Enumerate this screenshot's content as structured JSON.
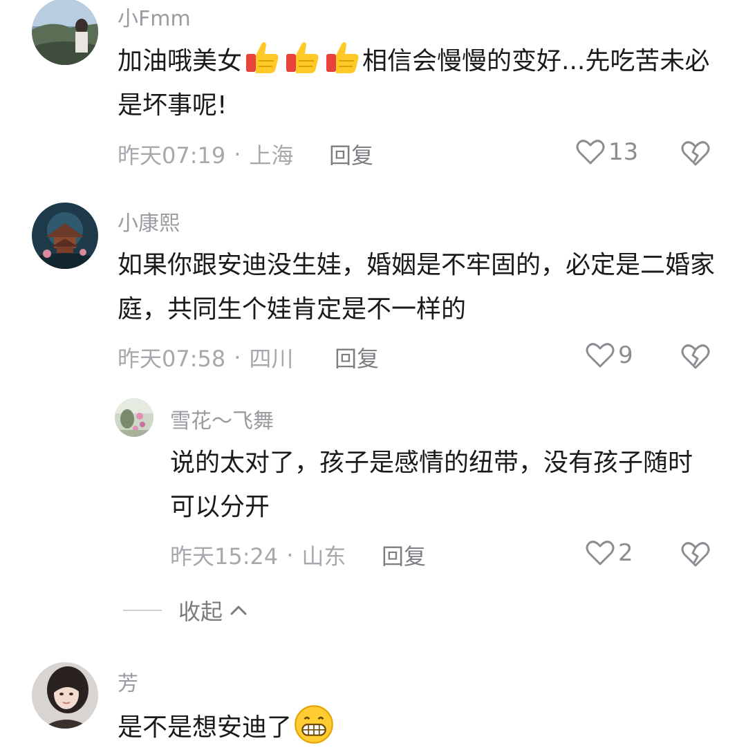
{
  "comments": [
    {
      "username": "小Fmm",
      "text_before": "加油哦美女",
      "text_after": "相信会慢慢的变好...先吃苦未必是坏事呢!",
      "time": "昨天07:19",
      "location": "上海",
      "reply_label": "回复",
      "likes": "13",
      "emojis": [
        "thumbs-up-icon",
        "thumbs-up-icon",
        "thumbs-up-icon"
      ]
    },
    {
      "username": "小康熙",
      "text": "如果你跟安迪没生娃，婚姻是不牢固的，必定是二婚家庭，共同生个娃肯定是不一样的",
      "time": "昨天07:58",
      "location": "四川",
      "reply_label": "回复",
      "likes": "9",
      "replies": [
        {
          "username": "雪花～飞舞",
          "text": "说的太对了，孩子是感情的纽带，没有孩子随时可以分开",
          "time": "昨天15:24",
          "location": "山东",
          "reply_label": "回复",
          "likes": "2"
        }
      ],
      "collapse_label": "收起"
    },
    {
      "username": "芳",
      "text": "是不是想安迪了",
      "emoji": "grinning-face-icon"
    }
  ],
  "separator": "·",
  "colors": {
    "username": "#9a9aa0",
    "meta": "#a7a7ad",
    "text": "#1a1a1a"
  }
}
